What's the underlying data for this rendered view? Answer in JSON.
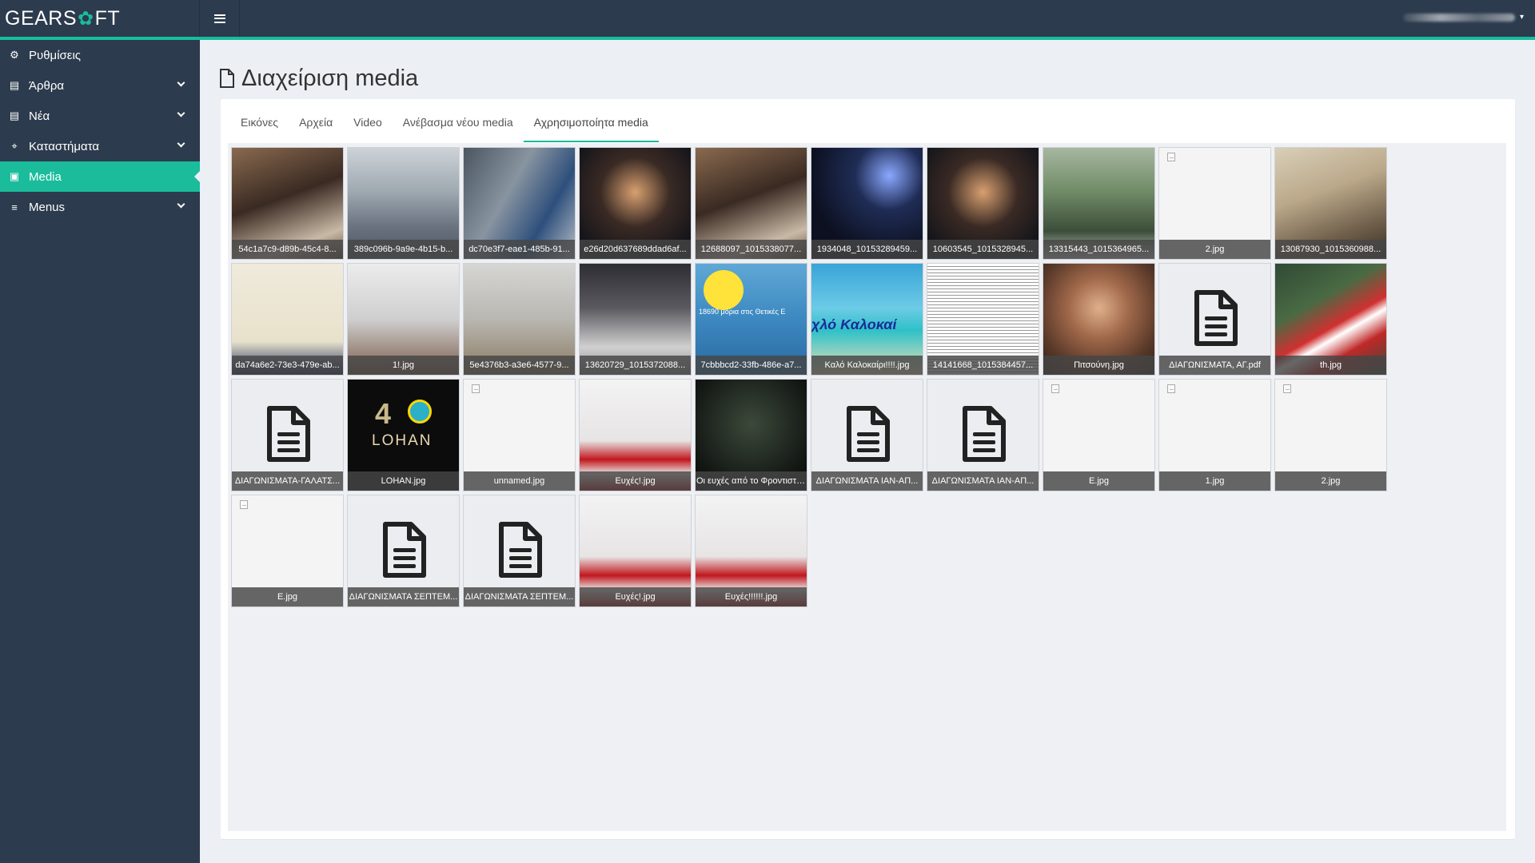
{
  "app": {
    "logo_left": "GEARS",
    "logo_gear": "✿",
    "logo_right": "FT",
    "menu_toggle_icon": "hamburger-icon",
    "user_caret": "▾"
  },
  "sidebar": {
    "items": [
      {
        "label": "Ρυθμίσεις",
        "icon": "⚙",
        "has_children": false,
        "active": false
      },
      {
        "label": "Άρθρα",
        "icon": "▤",
        "has_children": true,
        "active": false
      },
      {
        "label": "Νέα",
        "icon": "▤",
        "has_children": true,
        "active": false
      },
      {
        "label": "Καταστήματα",
        "icon": "⌖",
        "has_children": true,
        "active": false
      },
      {
        "label": "Media",
        "icon": "▣",
        "has_children": false,
        "active": true
      },
      {
        "label": "Menus",
        "icon": "≡",
        "has_children": true,
        "active": false
      }
    ]
  },
  "page": {
    "title": "Διαχείριση media"
  },
  "tabs": [
    {
      "label": "Εικόνες",
      "active": false
    },
    {
      "label": "Αρχεία",
      "active": false
    },
    {
      "label": "Video",
      "active": false
    },
    {
      "label": "Ανέβασμα νέου media",
      "active": false
    },
    {
      "label": "Αχρησιμοποίητα media",
      "active": true
    }
  ],
  "media": [
    {
      "caption": "54c1a7c9-d89b-45c4-8...",
      "kind": "photo",
      "style": "p-warm"
    },
    {
      "caption": "389c096b-9a9e-4b15-b...",
      "kind": "photo",
      "style": "p-office"
    },
    {
      "caption": "dc70e3f7-eae1-485b-91...",
      "kind": "photo",
      "style": "p-office2"
    },
    {
      "caption": "e26d20d637689ddad6af...",
      "kind": "photo",
      "style": "p-night2"
    },
    {
      "caption": "12688097_1015338077...",
      "kind": "photo",
      "style": "p-warm"
    },
    {
      "caption": "1934048_10153289459...",
      "kind": "photo",
      "style": "p-night"
    },
    {
      "caption": "10603545_1015328945...",
      "kind": "photo",
      "style": "p-night2"
    },
    {
      "caption": "13315443_1015364965...",
      "kind": "photo",
      "style": "p-outdoor"
    },
    {
      "caption": "2.jpg",
      "kind": "broken",
      "style": ""
    },
    {
      "caption": "13087930_1015360988...",
      "kind": "photo",
      "style": "p-man"
    },
    {
      "caption": "da74a6e2-73e3-479e-ab...",
      "kind": "photo",
      "style": "p-logo"
    },
    {
      "caption": "1!.jpg",
      "kind": "photo",
      "style": "p-girl"
    },
    {
      "caption": "5e4376b3-a3e6-4577-9...",
      "kind": "photo",
      "style": "p-room"
    },
    {
      "caption": "13620729_1015372088...",
      "kind": "photo",
      "style": "p-desk"
    },
    {
      "caption": "7cbbbcd2-33fb-486e-a7...",
      "kind": "photo",
      "style": "p-blue",
      "overlay": "18690 μόρια στις Θετικές Ε"
    },
    {
      "caption": "Καλό Καλοκαίρι!!!!.jpg",
      "kind": "photo",
      "style": "p-beach",
      "overlay_blue": "χλό Καλοκαί"
    },
    {
      "caption": "14141668_1015384457...",
      "kind": "photo",
      "style": "p-list"
    },
    {
      "caption": "Πιτσούνη.jpg",
      "kind": "photo",
      "style": "p-portrait"
    },
    {
      "caption": "ΔΙΑΓΩΝΙΣΜΑΤΑ, ΑΓ.pdf",
      "kind": "file",
      "style": ""
    },
    {
      "caption": "th.jpg",
      "kind": "photo",
      "style": "p-flag"
    },
    {
      "caption": "ΔΙΑΓΩΝΙΣΜΑΤΑ-ΓΑΛΑΤΣ...",
      "kind": "file",
      "style": ""
    },
    {
      "caption": "LOHAN.jpg",
      "kind": "photo",
      "style": "p-lohan",
      "lohan": "LOHAN"
    },
    {
      "caption": "unnamed.jpg",
      "kind": "broken",
      "style": ""
    },
    {
      "caption": "Ευχές!.jpg",
      "kind": "photo",
      "style": "p-xmas"
    },
    {
      "caption": "Οι ευχές από το Φροντιστή...",
      "kind": "photo",
      "style": "p-xmas-night"
    },
    {
      "caption": "ΔΙΑΓΩΝΙΣΜΑΤΑ ΙΑΝ-ΑΠ...",
      "kind": "file",
      "style": ""
    },
    {
      "caption": "ΔΙΑΓΩΝΙΣΜΑΤΑ ΙΑΝ-ΑΠ...",
      "kind": "file",
      "style": ""
    },
    {
      "caption": "E.jpg",
      "kind": "broken",
      "style": ""
    },
    {
      "caption": "1.jpg",
      "kind": "broken",
      "style": ""
    },
    {
      "caption": "2.jpg",
      "kind": "broken",
      "style": ""
    },
    {
      "caption": "E.jpg",
      "kind": "broken",
      "style": ""
    },
    {
      "caption": "ΔΙΑΓΩΝΙΣΜΑΤΑ ΣΕΠΤΕΜ...",
      "kind": "file",
      "style": ""
    },
    {
      "caption": "ΔΙΑΓΩΝΙΣΜΑΤΑ ΣΕΠΤΕΜ...",
      "kind": "file",
      "style": ""
    },
    {
      "caption": "Ευχές!.jpg",
      "kind": "photo",
      "style": "p-xmas"
    },
    {
      "caption": "Ευχές!!!!!!.jpg",
      "kind": "photo",
      "style": "p-xmas"
    }
  ],
  "colors": {
    "sidebar_bg": "#2c3b4d",
    "accent": "#1abc9c",
    "content_bg": "#ecf0f5"
  }
}
